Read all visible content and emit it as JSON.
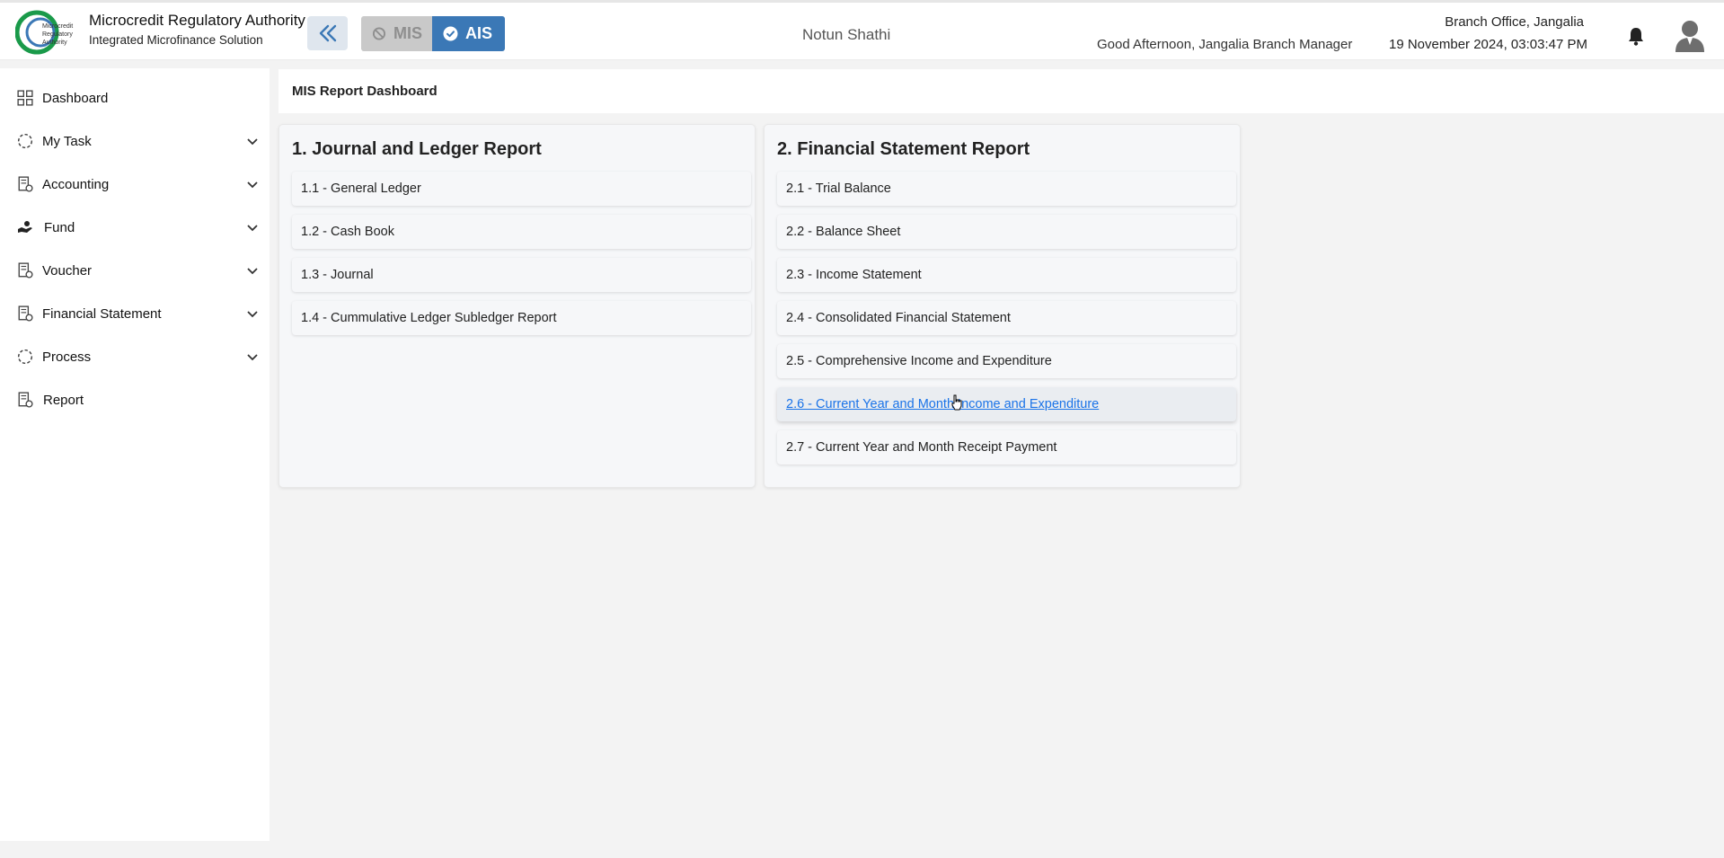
{
  "header": {
    "org_name": "Microcredit Regulatory Authority",
    "org_subtitle": "Integrated Microfinance Solution",
    "logo_text": "Microcredit Regulatory Authority",
    "mode_mis": "MIS",
    "mode_ais": "AIS",
    "app_title": "Notun Shathi",
    "greeting": "Good Afternoon, Jangalia Branch Manager",
    "branch": "Branch Office, Jangalia",
    "datetime": "19 November 2024, 03:03:47 PM",
    "colors": {
      "accent": "#3b78b6",
      "logo_green": "#1a9a4a",
      "disabled": "#c9c9c9"
    }
  },
  "sidebar": {
    "items": [
      {
        "label": "Dashboard",
        "icon": "grid-icon",
        "expandable": false
      },
      {
        "label": "My Task",
        "icon": "dashed-circle-icon",
        "expandable": true
      },
      {
        "label": "Accounting",
        "icon": "ledger-icon",
        "expandable": true
      },
      {
        "label": "Fund",
        "icon": "hand-coin-icon",
        "expandable": true
      },
      {
        "label": "Voucher",
        "icon": "ledger-icon",
        "expandable": true
      },
      {
        "label": "Financial Statement",
        "icon": "ledger-icon",
        "expandable": true
      },
      {
        "label": "Process",
        "icon": "dashed-circle-icon",
        "expandable": true
      },
      {
        "label": "Report",
        "icon": "ledger-icon",
        "expandable": false
      }
    ]
  },
  "main": {
    "page_title": "MIS Report Dashboard",
    "cards": [
      {
        "title": "1. Journal and Ledger Report",
        "items": [
          "1.1 - General Ledger",
          "1.2 - Cash Book",
          "1.3 - Journal",
          "1.4 - Cummulative Ledger Subledger Report"
        ]
      },
      {
        "title": "2. Financial Statement Report",
        "items": [
          "2.1 - Trial Balance",
          "2.2 - Balance Sheet",
          "2.3 - Income Statement",
          "2.4 - Consolidated Financial Statement",
          "2.5 - Comprehensive Income and Expenditure",
          "2.6 - Current Year and Month Income and Expenditure",
          "2.7 - Current Year and Month Receipt Payment"
        ],
        "active_index": 5
      }
    ]
  }
}
